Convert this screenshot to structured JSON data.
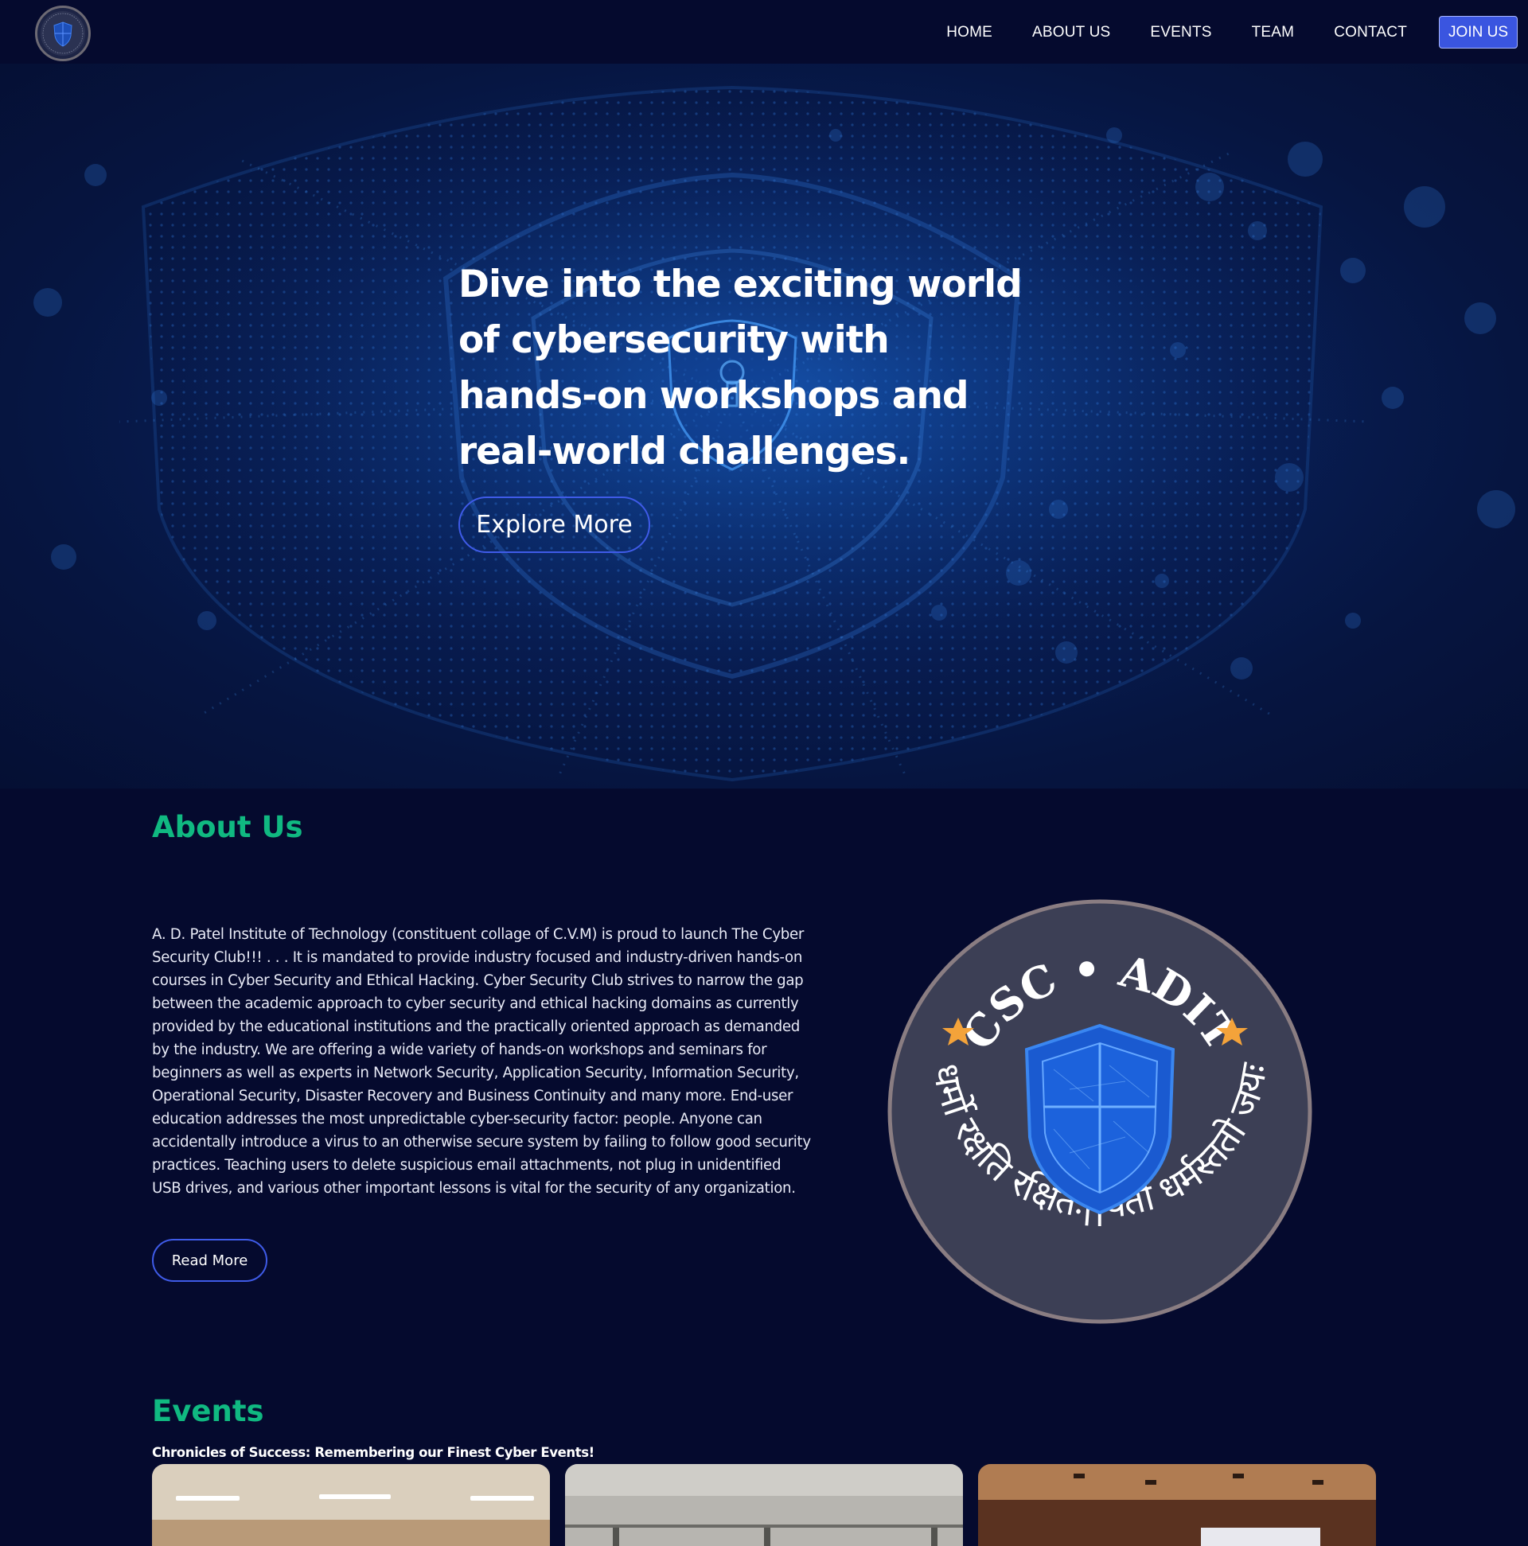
{
  "nav": {
    "links": [
      "HOME",
      "ABOUT US",
      "EVENTS",
      "TEAM",
      "CONTACT"
    ],
    "join_label": "JOIN US",
    "logo_text": "CSC • ADIT"
  },
  "hero": {
    "title": "Dive into the exciting world of cybersecurity with hands-on workshops and real-world challenges.",
    "cta_label": "Explore More"
  },
  "about": {
    "heading": "About Us",
    "body": "A. D. Patel Institute of Technology (constituent collage of C.V.M) is proud to launch The Cyber Security Club!!! . . . It is mandated to provide industry focused and industry-driven hands-on courses in Cyber Security and Ethical Hacking. Cyber Security Club strives to narrow the gap between the academic approach to cyber security and ethical hacking domains as currently provided by the educational institutions and the practically oriented approach as demanded by the industry. We are offering a wide variety of hands-on workshops and seminars for beginners as well as experts in Network Security, Application Security, Information Security, Operational Security, Disaster Recovery and Business Continuity and many more. End-user education addresses the most unpredictable cyber-security factor: people. Anyone can accidentally introduce a virus to an otherwise secure system by failing to follow good security practices. Teaching users to delete suspicious email attachments, not plug in unidentified USB drives, and various other important lessons is vital for the security of any organization.",
    "read_more_label": "Read More",
    "emblem_top_text": "CSC • ADIT",
    "emblem_motto": "धर्मो रक्षति रक्षितः||यतो धर्मस्ततो जयः"
  },
  "events": {
    "heading": "Events",
    "subtitle": "Chronicles of Success: Remembering our Finest Cyber Events!"
  },
  "colors": {
    "background": "#050a2e",
    "accent_green": "#10b981",
    "accent_blue": "#3a55e0"
  }
}
